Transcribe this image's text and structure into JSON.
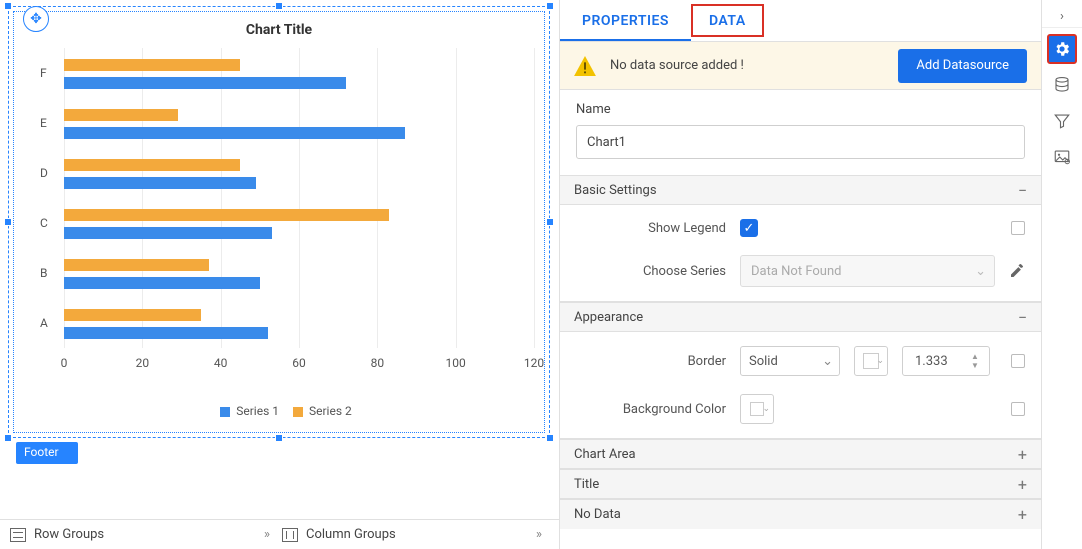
{
  "chart": {
    "title": "Chart Title",
    "footer_label": "Footer"
  },
  "chart_data": {
    "type": "bar",
    "orientation": "horizontal",
    "categories": [
      "A",
      "B",
      "C",
      "D",
      "E",
      "F"
    ],
    "series": [
      {
        "name": "Series 1",
        "color": "#3a8bea",
        "values": [
          52,
          50,
          53,
          49,
          87,
          72
        ]
      },
      {
        "name": "Series 2",
        "color": "#f3a93c",
        "values": [
          35,
          37,
          83,
          45,
          29,
          45
        ]
      }
    ],
    "xlim": [
      0,
      120
    ],
    "xticks": [
      0,
      20,
      40,
      60,
      80,
      100,
      120
    ]
  },
  "groups": {
    "row_label": "Row Groups",
    "col_label": "Column Groups"
  },
  "tabs": {
    "properties": "PROPERTIES",
    "data": "DATA"
  },
  "alert": {
    "msg": "No data source added !",
    "button": "Add Datasource"
  },
  "name": {
    "label": "Name",
    "value": "Chart1"
  },
  "sections": {
    "basic": "Basic Settings",
    "appearance": "Appearance",
    "chart_area": "Chart Area",
    "title": "Title",
    "no_data": "No Data"
  },
  "basic": {
    "show_legend": "Show Legend",
    "choose_series": "Choose Series",
    "series_placeholder": "Data Not Found"
  },
  "appearance": {
    "border": "Border",
    "border_style": "Solid",
    "border_width": "1.333",
    "bg": "Background Color"
  }
}
